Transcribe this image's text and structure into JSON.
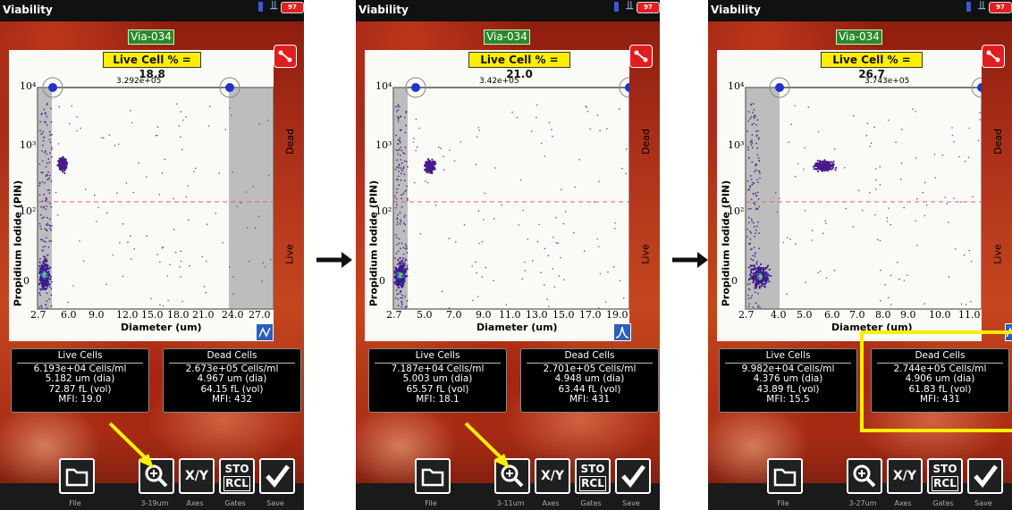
{
  "status_title": "Viability",
  "battery_label": "97",
  "panels": [
    {
      "vial": "Via-034",
      "live_cell": "Live Cell % = 18.8",
      "gate_count": "3.292e+05",
      "y_ticks": [
        "10⁴",
        "10³",
        "10²",
        "0"
      ],
      "x_ticks": [
        "2.7",
        "6.0",
        "9.0",
        "12.0",
        "15.0",
        "18.0",
        "21.0",
        "24.0",
        "27.0"
      ],
      "xlabel": "Diameter (um)",
      "ylabel": "Propidium Iodide (PIN)",
      "dead_label": "Dead",
      "live_label": "Live",
      "live_stats": {
        "header": "Live Cells",
        "conc": "6.193e+04 Cells/ml",
        "dia": "5.182 um (dia)",
        "vol": "72.87 fL (vol)",
        "mfi": "MFI:  19.0"
      },
      "dead_stats": {
        "header": "Dead Cells",
        "conc": "2.673e+05 Cells/ml",
        "dia": "4.967 um (dia)",
        "vol": "64.15 fL (vol)",
        "mfi": "MFI:   432"
      },
      "buttons": {
        "file": "File",
        "zoom": "3-19um",
        "axes": "Axes",
        "gates": "Gates",
        "save": "Save",
        "xy": "X/Y",
        "sto": "STO",
        "rcl": "RCL"
      }
    },
    {
      "vial": "Via-034",
      "live_cell": "Live Cell % = 21.0",
      "gate_count": "3.42e+05",
      "y_ticks": [
        "10⁴",
        "10³",
        "10²",
        "0"
      ],
      "x_ticks": [
        "2.7",
        "5.0",
        "7.0",
        "9.0",
        "11.0",
        "13.0",
        "15.0",
        "17.0",
        "19.0"
      ],
      "xlabel": "Diameter (um)",
      "ylabel": "Propidium Iodide (PIN)",
      "dead_label": "Dead",
      "live_label": "Live",
      "live_stats": {
        "header": "Live Cells",
        "conc": "7.187e+04 Cells/ml",
        "dia": "5.003 um (dia)",
        "vol": "65.57 fL (vol)",
        "mfi": "MFI:  18.1"
      },
      "dead_stats": {
        "header": "Dead Cells",
        "conc": "2.701e+05 Cells/ml",
        "dia": "4.948 um (dia)",
        "vol": "63.44 fL (vol)",
        "mfi": "MFI:   431"
      },
      "buttons": {
        "file": "File",
        "zoom": "3-11um",
        "axes": "Axes",
        "gates": "Gates",
        "save": "Save",
        "xy": "X/Y",
        "sto": "STO",
        "rcl": "RCL"
      }
    },
    {
      "vial": "Via-034",
      "live_cell": "Live Cell % = 26.7",
      "gate_count": "3.743e+05",
      "y_ticks": [
        "10⁴",
        "10³",
        "10²",
        "0"
      ],
      "x_ticks": [
        "2.7",
        "4.0",
        "5.0",
        "6.0",
        "7.0",
        "8.0",
        "9.0",
        "10.0",
        "11.0"
      ],
      "xlabel": "Diameter (um)",
      "ylabel": "Propidium Iodide (PIN)",
      "dead_label": "Dead",
      "live_label": "Live",
      "live_stats": {
        "header": "Live Cells",
        "conc": "9.982e+04 Cells/ml",
        "dia": "4.376 um (dia)",
        "vol": "43.89 fL (vol)",
        "mfi": "MFI:  15.5"
      },
      "dead_stats": {
        "header": "Dead Cells",
        "conc": "2.744e+05 Cells/ml",
        "dia": "4.906 um (dia)",
        "vol": "61.83 fL (vol)",
        "mfi": "MFI:   431"
      },
      "buttons": {
        "file": "File",
        "zoom": "3-27um",
        "axes": "Axes",
        "gates": "Gates",
        "save": "Save",
        "xy": "X/Y",
        "sto": "STO",
        "rcl": "RCL"
      }
    }
  ],
  "colors": {
    "accent_yellow": "#ffee00",
    "vial_green": "#2a8a2a",
    "status_red": "#e21d1d",
    "gate_blue": "#2233cc"
  }
}
